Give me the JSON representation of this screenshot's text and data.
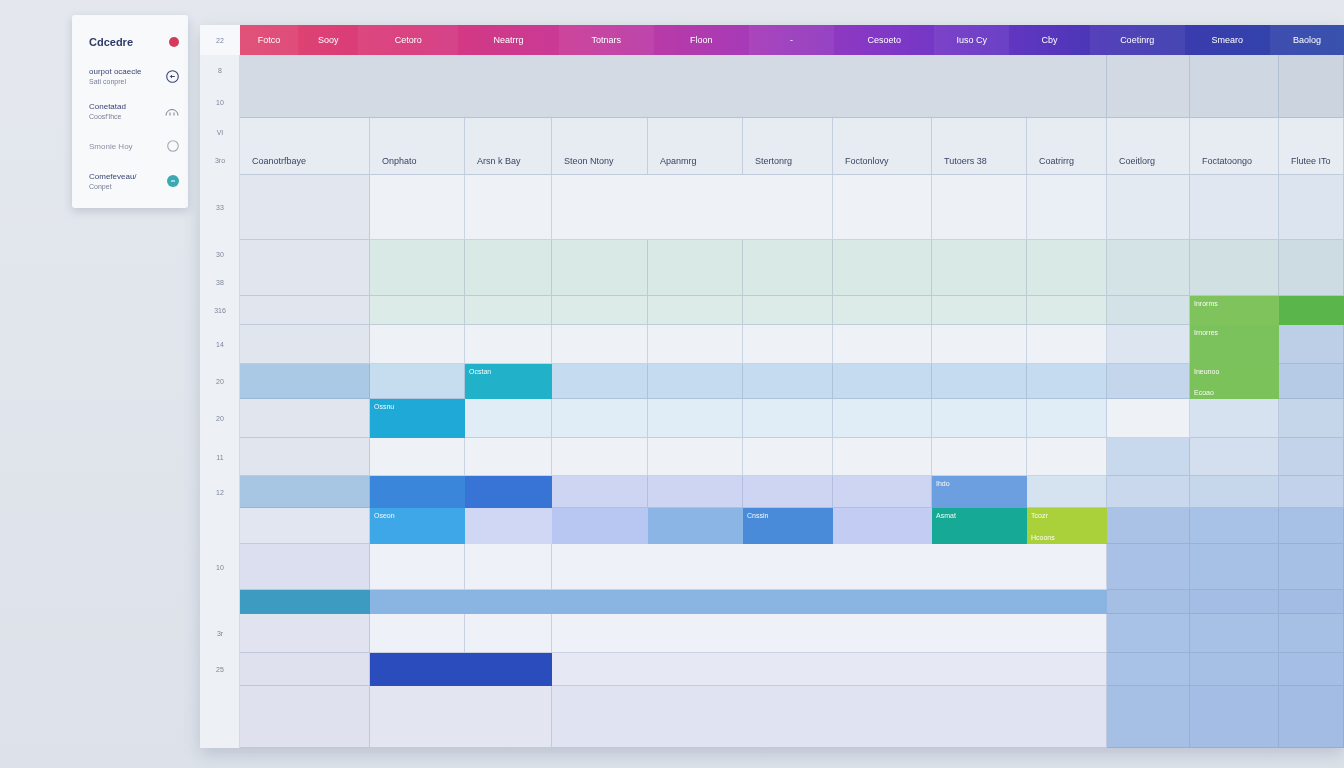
{
  "sidebar": {
    "title": "Cdcedre",
    "items": [
      {
        "kind": "back",
        "label": "ourpot ocaecle",
        "sublabel": "Sati conprel"
      },
      {
        "kind": "arch",
        "label": "Conetatad",
        "sublabel": "Coosf'lhce"
      },
      {
        "kind": "ring",
        "label": "Smonie Hoy"
      },
      {
        "kind": "dot",
        "label": "Comefeveau/",
        "sublabel": "Conpet"
      }
    ]
  },
  "calendar": {
    "bar_time": "22",
    "bar_labels": [
      "Fotco",
      "Sooy",
      "Cetoro",
      "Neatrrg",
      "Totnars",
      "Floon",
      "-",
      "Cesoeto",
      "Iuso Cy",
      "Cby",
      "Coetinrg",
      "Smearo",
      "Baolog"
    ],
    "band": {
      "kind": "wide",
      "times": [
        "8",
        "10"
      ],
      "cells": [
        {
          "kind": "slot",
          "color": "#d3dae3"
        },
        {
          "kind": "slot",
          "color": "#d2d9e3"
        },
        {
          "kind": "slot",
          "color": "#cfd7e2"
        },
        {
          "kind": "slot",
          "color": "#ccd4e0"
        }
      ]
    },
    "header_times": [
      "VI",
      "3ro"
    ],
    "columns": [
      "Coanotrfbaye",
      "Onphato",
      "Arsn k Bay",
      "Steon Ntony",
      "Apanmrg",
      "Stertonrg",
      "Foctonlovy",
      "Tutoers 38",
      "Coatrirrg",
      "Coeitlorg",
      "Foctatoongo",
      "Flutee ITo"
    ],
    "rows": [
      {
        "kind": "mid",
        "times": [
          "33"
        ],
        "cells": [
          {
            "kind": "slot",
            "color": "#e2e7ef"
          },
          {
            "kind": "slot",
            "color": "#eef2f7"
          },
          {
            "kind": "slot",
            "color": "#eef2f7"
          },
          {
            "kind": "slot",
            "color": "#eef2f7"
          },
          {
            "kind": "slot",
            "color": "#eef2f7"
          },
          {
            "kind": "slot",
            "color": "#edf1f6"
          },
          {
            "kind": "slot",
            "color": "#eaeff5"
          },
          {
            "kind": "slot",
            "color": "#e4eaf2"
          },
          {
            "kind": "slot",
            "color": "#e0e7f1"
          },
          {
            "kind": "slot",
            "color": "#dbe4ef"
          }
        ]
      },
      {
        "kind": "grid",
        "times": [
          "30",
          "38"
        ],
        "cells": [
          {
            "kind": "slot",
            "color": "#e1e6ee"
          },
          {
            "kind": "slot",
            "color": "#d9e9e5"
          },
          {
            "kind": "slot",
            "color": "#d9e9e5"
          },
          {
            "kind": "slot",
            "color": "#d9e9e5"
          },
          {
            "kind": "slot",
            "color": "#d9e9e5"
          },
          {
            "kind": "slot",
            "color": "#d9e9e5"
          },
          {
            "kind": "slot",
            "color": "#d9e9e5"
          },
          {
            "kind": "slot",
            "color": "#d9e9e5"
          },
          {
            "kind": "slot",
            "color": "#d9e9e5"
          },
          {
            "kind": "slot",
            "color": "#d4e3e5"
          },
          {
            "kind": "slot",
            "color": "#d1e0e3"
          },
          {
            "kind": "slot",
            "color": "#cddce2"
          }
        ]
      },
      {
        "kind": "grid",
        "times": [
          "316"
        ],
        "cells": [
          {
            "kind": "slot",
            "color": "#e1e6ee"
          },
          {
            "kind": "slot",
            "color": "#dcebe7"
          },
          {
            "kind": "slot",
            "color": "#dcebe7"
          },
          {
            "kind": "slot",
            "color": "#dcebe7"
          },
          {
            "kind": "slot",
            "color": "#dcebe7"
          },
          {
            "kind": "slot",
            "color": "#dcebe7"
          },
          {
            "kind": "slot",
            "color": "#dcebe7"
          },
          {
            "kind": "slot",
            "color": "#dcebe7"
          },
          {
            "kind": "slot",
            "color": "#dcebe7"
          },
          {
            "kind": "slot",
            "color": "#d3e2e6"
          },
          {
            "kind": "event",
            "color": "#7ec35c",
            "text": "Inrorms"
          },
          {
            "kind": "event",
            "color": "#5ab64a"
          }
        ]
      },
      {
        "kind": "grid",
        "times": [
          "14"
        ],
        "cells": [
          {
            "kind": "slot",
            "color": "#e1e6ee"
          },
          {
            "kind": "slot",
            "color": "#eef2f6"
          },
          {
            "kind": "slot",
            "color": "#eef2f6"
          },
          {
            "kind": "slot",
            "color": "#eef2f6"
          },
          {
            "kind": "slot",
            "color": "#eef2f6"
          },
          {
            "kind": "slot",
            "color": "#eef2f6"
          },
          {
            "kind": "slot",
            "color": "#eef2f6"
          },
          {
            "kind": "slot",
            "color": "#eef2f6"
          },
          {
            "kind": "slot",
            "color": "#eef2f6"
          },
          {
            "kind": "slot",
            "color": "#dde6f0"
          },
          {
            "kind": "event",
            "color": "#7cc25c",
            "text": "Irnorres"
          },
          {
            "kind": "slot",
            "color": "#bccfe7"
          }
        ]
      },
      {
        "kind": "grid",
        "times": [
          "20"
        ],
        "cells": [
          {
            "kind": "slot",
            "color": "#a9c9e4"
          },
          {
            "kind": "slot",
            "color": "#c6dcef"
          },
          {
            "kind": "event",
            "color": "#21b2c9",
            "text": "Ocstan"
          },
          {
            "kind": "slot",
            "color": "#c5dbef"
          },
          {
            "kind": "slot",
            "color": "#c5dbef"
          },
          {
            "kind": "slot",
            "color": "#c5dbef"
          },
          {
            "kind": "slot",
            "color": "#c5dbef"
          },
          {
            "kind": "slot",
            "color": "#c5dbef"
          },
          {
            "kind": "slot",
            "color": "#c5dbef"
          },
          {
            "kind": "slot",
            "color": "#c3d6ec"
          },
          {
            "kind": "event",
            "color": "#7cc25a",
            "text": "Ineunoo",
            "subtext": "Ecoao"
          },
          {
            "kind": "slot",
            "color": "#b6cbe6"
          }
        ]
      },
      {
        "kind": "grid",
        "times": [
          "20"
        ],
        "cells": [
          {
            "kind": "slot",
            "color": "#e1e6ee"
          },
          {
            "kind": "event",
            "color": "#1ea9d6",
            "text": "Ossnu"
          },
          {
            "kind": "slot",
            "color": "#e1edf6"
          },
          {
            "kind": "slot",
            "color": "#e1edf6"
          },
          {
            "kind": "slot",
            "color": "#e1edf6"
          },
          {
            "kind": "slot",
            "color": "#e1edf6"
          },
          {
            "kind": "slot",
            "color": "#e1edf6"
          },
          {
            "kind": "slot",
            "color": "#e1edf6"
          },
          {
            "kind": "slot",
            "color": "#e1edf6"
          },
          {
            "kind": "slot",
            "color": "#eef2f6"
          },
          {
            "kind": "slot",
            "color": "#d6e2ef"
          },
          {
            "kind": "slot",
            "color": "#c5d5ea"
          }
        ]
      },
      {
        "kind": "grid",
        "times": [
          "11"
        ],
        "cells": [
          {
            "kind": "slot",
            "color": "#e1e6ee"
          },
          {
            "kind": "slot",
            "color": "#eef2f7"
          },
          {
            "kind": "slot",
            "color": "#eef2f7"
          },
          {
            "kind": "slot",
            "color": "#eef2f7"
          },
          {
            "kind": "slot",
            "color": "#eef2f7"
          },
          {
            "kind": "slot",
            "color": "#eef2f7"
          },
          {
            "kind": "slot",
            "color": "#eef2f7"
          },
          {
            "kind": "slot",
            "color": "#eef2f7"
          },
          {
            "kind": "slot",
            "color": "#eef2f7"
          },
          {
            "kind": "slot",
            "color": "#c9d9ed"
          },
          {
            "kind": "slot",
            "color": "#d3dfee"
          },
          {
            "kind": "slot",
            "color": "#c2d3ea"
          }
        ]
      },
      {
        "kind": "grid",
        "times": [
          "12"
        ],
        "cells": [
          {
            "kind": "slot",
            "color": "#a6c6e4"
          },
          {
            "kind": "event",
            "color": "#3a86da"
          },
          {
            "kind": "event",
            "color": "#3873d6"
          },
          {
            "kind": "slot",
            "color": "#cdd5f3"
          },
          {
            "kind": "slot",
            "color": "#cdd5f3"
          },
          {
            "kind": "slot",
            "color": "#cdd5f3"
          },
          {
            "kind": "slot",
            "color": "#cdd5f3"
          },
          {
            "kind": "event",
            "color": "#6c9fe0",
            "text": "Ihdo"
          },
          {
            "kind": "slot",
            "color": "#d5e3f0"
          },
          {
            "kind": "slot",
            "color": "#c9d8ec"
          },
          {
            "kind": "slot",
            "color": "#c6d6eb"
          },
          {
            "kind": "slot",
            "color": "#c1d2ea"
          }
        ]
      },
      {
        "kind": "grid",
        "cells": [
          {
            "kind": "slot",
            "color": "#e2e6f0"
          },
          {
            "kind": "event",
            "color": "#3da7e8",
            "text": "Oseon"
          },
          {
            "kind": "event",
            "color": "#cfd7f4"
          },
          {
            "kind": "event",
            "color": "#b7c7f1"
          },
          {
            "kind": "event",
            "color": "#8bb5e5"
          },
          {
            "kind": "event",
            "color": "#4a8bd9",
            "text": "Cnssin"
          },
          {
            "kind": "event",
            "color": "#c3cdf3"
          },
          {
            "kind": "event",
            "color": "#16a995",
            "text": "Asmat"
          },
          {
            "kind": "event",
            "color": "#abd13a",
            "text": "Tcozr",
            "subtext": "Hcoons"
          },
          {
            "kind": "slot",
            "color": "#a9c2e6"
          },
          {
            "kind": "slot",
            "color": "#a8c1e6"
          },
          {
            "kind": "slot",
            "color": "#a7c0e5"
          }
        ]
      },
      {
        "kind": "open",
        "times": [
          "10"
        ],
        "cells": [
          {
            "kind": "slot",
            "color": "#dcdff0"
          },
          {
            "kind": "slot",
            "color": "#eef1f7"
          },
          {
            "kind": "slot",
            "color": "#eef1f7"
          },
          {
            "kind": "slot",
            "color": "#eef1f7"
          },
          {
            "kind": "slot",
            "color": "#a9c1e6"
          },
          {
            "kind": "slot",
            "color": "#a7c0e5"
          },
          {
            "kind": "slot",
            "color": "#a6bfe5"
          }
        ]
      },
      {
        "kind": "bar",
        "cells": [
          {
            "kind": "event",
            "color": "#3d9bc1"
          },
          {
            "kind": "event",
            "color": "#8ab5e3"
          },
          {
            "kind": "slot",
            "color": "#a5bfe4"
          },
          {
            "kind": "slot",
            "color": "#a3bde4"
          },
          {
            "kind": "slot",
            "color": "#a2bce3"
          }
        ]
      },
      {
        "kind": "open",
        "times": [
          "3r"
        ],
        "cells": [
          {
            "kind": "slot",
            "color": "#e1e3f0"
          },
          {
            "kind": "slot",
            "color": "#eef1f7"
          },
          {
            "kind": "slot",
            "color": "#eef1f7"
          },
          {
            "kind": "slot",
            "color": "#eef1f7"
          },
          {
            "kind": "slot",
            "color": "#a8c1e6"
          },
          {
            "kind": "slot",
            "color": "#a7c0e5"
          },
          {
            "kind": "slot",
            "color": "#a6bfe5"
          }
        ]
      },
      {
        "kind": "block",
        "times": [
          "25"
        ],
        "cells": [
          {
            "kind": "slot",
            "color": "#dfe1ee"
          },
          {
            "kind": "event",
            "color": "#2a4cbc"
          },
          {
            "kind": "slot",
            "color": "#e6e8f3"
          },
          {
            "kind": "slot",
            "color": "#a8c1e6"
          },
          {
            "kind": "slot",
            "color": "#a6bfe5"
          },
          {
            "kind": "slot",
            "color": "#a4bee5"
          }
        ]
      },
      {
        "kind": "block",
        "cells": [
          {
            "kind": "slot",
            "color": "#dfe1ee"
          },
          {
            "kind": "slot",
            "color": "#e3e5f1"
          },
          {
            "kind": "slot",
            "color": "#e0e3f1"
          },
          {
            "kind": "slot",
            "color": "#a6bfe5"
          },
          {
            "kind": "slot",
            "color": "#a4bde4"
          },
          {
            "kind": "slot",
            "color": "#a2bce4"
          }
        ]
      }
    ]
  }
}
